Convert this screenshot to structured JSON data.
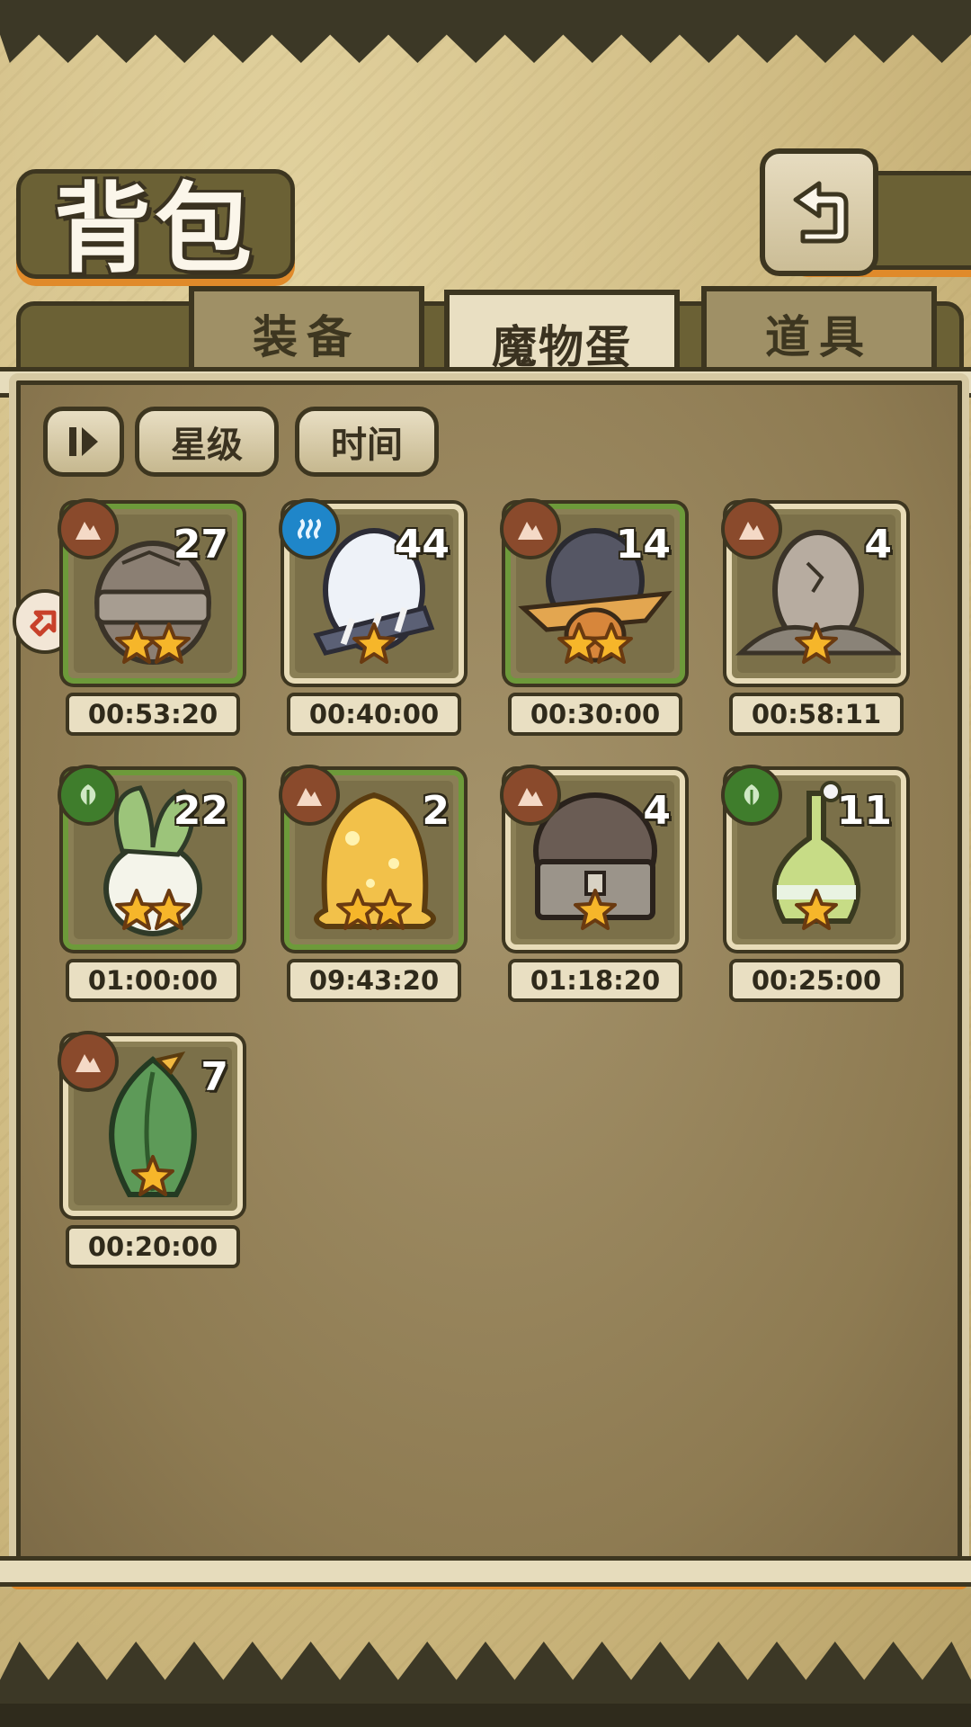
{
  "header": {
    "title": "背包"
  },
  "tabs": [
    {
      "label": "装备",
      "active": false
    },
    {
      "label": "魔物蛋",
      "active": true
    },
    {
      "label": "道具",
      "active": false
    }
  ],
  "sort": {
    "star_label": "星级",
    "time_label": "时间"
  },
  "eggs": [
    {
      "count": "27",
      "timer": "00:53:20",
      "stars": 2,
      "element": "earth",
      "frame": "green",
      "egg_icon": "rock-helmet-egg"
    },
    {
      "count": "44",
      "timer": "00:40:00",
      "stars": 1,
      "element": "water",
      "frame": "plain",
      "egg_icon": "white-striped-egg"
    },
    {
      "count": "14",
      "timer": "00:30:00",
      "stars": 2,
      "element": "earth",
      "frame": "green",
      "egg_icon": "witch-hat-egg"
    },
    {
      "count": "4",
      "timer": "00:58:11",
      "stars": 1,
      "element": "earth",
      "frame": "plain",
      "egg_icon": "cracked-rock-egg"
    },
    {
      "count": "22",
      "timer": "01:00:00",
      "stars": 2,
      "element": "nature",
      "frame": "green",
      "egg_icon": "turnip-egg"
    },
    {
      "count": "2",
      "timer": "09:43:20",
      "stars": 2,
      "element": "earth",
      "frame": "green",
      "egg_icon": "gold-slime-egg"
    },
    {
      "count": "4",
      "timer": "01:18:20",
      "stars": 1,
      "element": "earth",
      "frame": "plain",
      "egg_icon": "treasure-chest-egg"
    },
    {
      "count": "11",
      "timer": "00:25:00",
      "stars": 1,
      "element": "nature",
      "frame": "plain",
      "egg_icon": "flask-egg"
    },
    {
      "count": "7",
      "timer": "00:20:00",
      "stars": 1,
      "element": "earth",
      "frame": "plain",
      "egg_icon": "leaf-bud-egg"
    }
  ],
  "colors": {
    "earth_badge": "#8a4a2c",
    "water_badge": "#1f86c9",
    "nature_badge": "#3f7d2c",
    "frame_green": "#6d9a3a",
    "accent_orange": "#e08a2a"
  }
}
